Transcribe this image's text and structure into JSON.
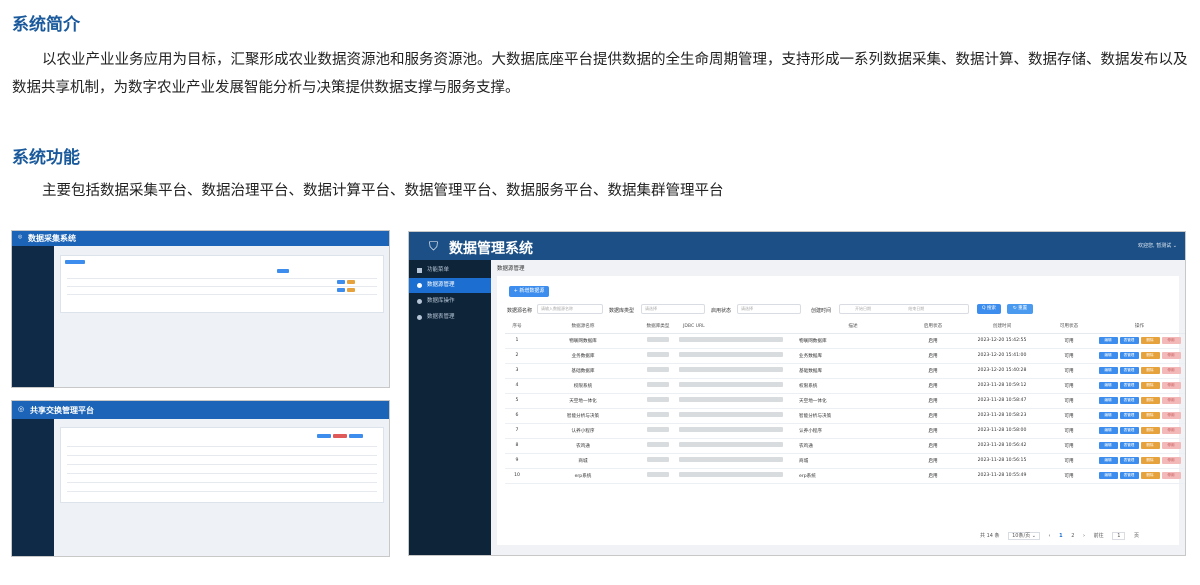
{
  "intro": {
    "heading": "系统简介",
    "text": "以农业产业业务应用为目标，汇聚形成农业数据资源池和服务资源池。大数据底座平台提供数据的全生命周期管理，支持形成一系列数据采集、数据计算、数据存储、数据发布以及数据共享机制，为数字农业产业发展智能分析与决策提供数据支撑与服务支撑。"
  },
  "features": {
    "heading": "系统功能",
    "text": "主要包括数据采集平台、数据治理平台、数据计算平台、数据管理平台、数据服务平台、数据集群管理平台"
  },
  "shot1": {
    "title": "数据采集系统"
  },
  "shot2": {
    "title": "共享交换管理平台"
  },
  "shot3": {
    "title": "数据管理系统",
    "user": "欢迎您, 暂测试 ⌄",
    "sidebar": [
      "功能菜单",
      "数据源管理",
      "数据库操作",
      "数据表管理"
    ],
    "breadcrumb": "数据源管理",
    "add_button": "+ 新增数据源",
    "filters": {
      "name_label": "数据源名称",
      "name_placeholder": "请输入数据源名称",
      "type_label": "数据库类型",
      "type_placeholder": "请选择",
      "status_label": "启用状态",
      "status_placeholder": "请选择",
      "time_label": "创建时间",
      "start_placeholder": "开始日期",
      "end_placeholder": "结束日期",
      "search_button": "Q 搜索",
      "reset_button": "↻ 重置"
    },
    "columns": [
      "序号",
      "数据源名称",
      "数据库类型",
      "JDBC URL",
      "描述",
      "启用状态",
      "创建时间",
      "可用状态",
      "操作"
    ],
    "rows": [
      {
        "no": "1",
        "name": "物联网数据库",
        "desc": "物联网数据库",
        "status": "启用",
        "time": "2023-12-20 15:42:55",
        "avail": "可用"
      },
      {
        "no": "2",
        "name": "业务数据库",
        "desc": "业务数据库",
        "status": "启用",
        "time": "2023-12-20 15:41:00",
        "avail": "可用"
      },
      {
        "no": "3",
        "name": "基础数据库",
        "desc": "基础数据库",
        "status": "启用",
        "time": "2023-12-20 15:40:28",
        "avail": "可用"
      },
      {
        "no": "4",
        "name": "权限系统",
        "desc": "权限系统",
        "status": "启用",
        "time": "2023-11-28 10:59:12",
        "avail": "可用"
      },
      {
        "no": "5",
        "name": "天空地一体化",
        "desc": "天空地一体化",
        "status": "启用",
        "time": "2023-11-28 10:58:47",
        "avail": "可用"
      },
      {
        "no": "6",
        "name": "智能分析与决策",
        "desc": "智能分析与决策",
        "status": "启用",
        "time": "2023-11-28 10:58:23",
        "avail": "可用"
      },
      {
        "no": "7",
        "name": "认养小程序",
        "desc": "认养小程序",
        "status": "启用",
        "time": "2023-11-28 10:58:00",
        "avail": "可用"
      },
      {
        "no": "8",
        "name": "农鸡通",
        "desc": "农鸡通",
        "status": "启用",
        "time": "2023-11-28 10:56:42",
        "avail": "可用"
      },
      {
        "no": "9",
        "name": "商城",
        "desc": "商城",
        "status": "启用",
        "time": "2023-11-28 10:56:15",
        "avail": "可用"
      },
      {
        "no": "10",
        "name": "erp系统",
        "desc": "erp系统",
        "status": "启用",
        "time": "2023-11-28 10:55:49",
        "avail": "可用"
      }
    ],
    "ops": {
      "edit": "编辑",
      "table": "表管理",
      "delete": "删除",
      "stop": "停用"
    },
    "pager": {
      "total": "共 14 条",
      "size": "10条/页 ⌄",
      "prev": "‹",
      "p1": "1",
      "p2": "2",
      "next": "›",
      "goto": "前往",
      "page": "1",
      "unit": "页"
    }
  }
}
